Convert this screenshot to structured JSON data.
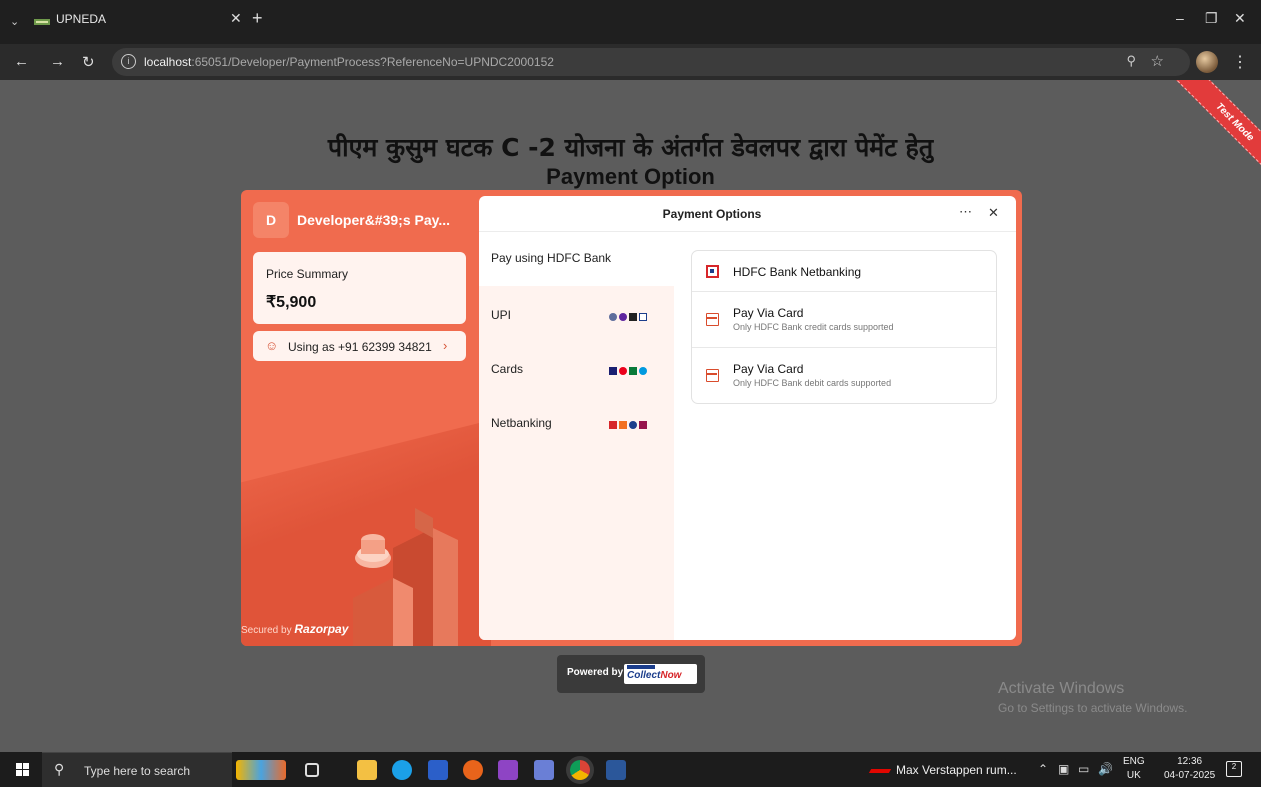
{
  "browser": {
    "tab_title": "UPNEDA",
    "url_host": "localhost",
    "url_rest": ":65051/Developer/PaymentProcess?ReferenceNo=UPNDC2000152"
  },
  "page": {
    "heading_hindi": "पीएम कुसुम घटक C -2 योजना के अंतर्गत डेवलपर द्वारा पेमेंट हेतु",
    "heading_english": "Payment Option",
    "ribbon": "Test Mode",
    "powered_by": "Powered by",
    "powered_brand_a": "Collect",
    "powered_brand_b": "Now"
  },
  "checkout": {
    "merchant_initial": "D",
    "merchant_name": "Developer&#39;s Pay...",
    "price_label": "Price Summary",
    "price_value": "₹5,900",
    "contact": "Using as +91 62399 34821",
    "secured_prefix": "Secured by",
    "secured_brand": "Razorpay",
    "panel_title": "Payment Options",
    "group_label": "Pay using HDFC Bank",
    "methods": [
      {
        "label": "UPI"
      },
      {
        "label": "Cards"
      },
      {
        "label": "Netbanking"
      }
    ],
    "options": [
      {
        "title": "HDFC Bank Netbanking",
        "subtitle": ""
      },
      {
        "title": "Pay Via Card",
        "subtitle": "Only HDFC Bank credit cards supported"
      },
      {
        "title": "Pay Via Card",
        "subtitle": "Only HDFC Bank debit cards supported"
      }
    ]
  },
  "windows": {
    "activate_title": "Activate Windows",
    "activate_sub": "Go to Settings to activate Windows."
  },
  "taskbar": {
    "search_placeholder": "Type here to search",
    "news": "Max Verstappen rum...",
    "lang_1": "ENG",
    "lang_2": "UK",
    "time": "12:36",
    "date": "04-07-2025",
    "notifications": "2"
  },
  "colors": {
    "checkout_accent": "#f06b4e",
    "ribbon": "#e23b3b"
  }
}
